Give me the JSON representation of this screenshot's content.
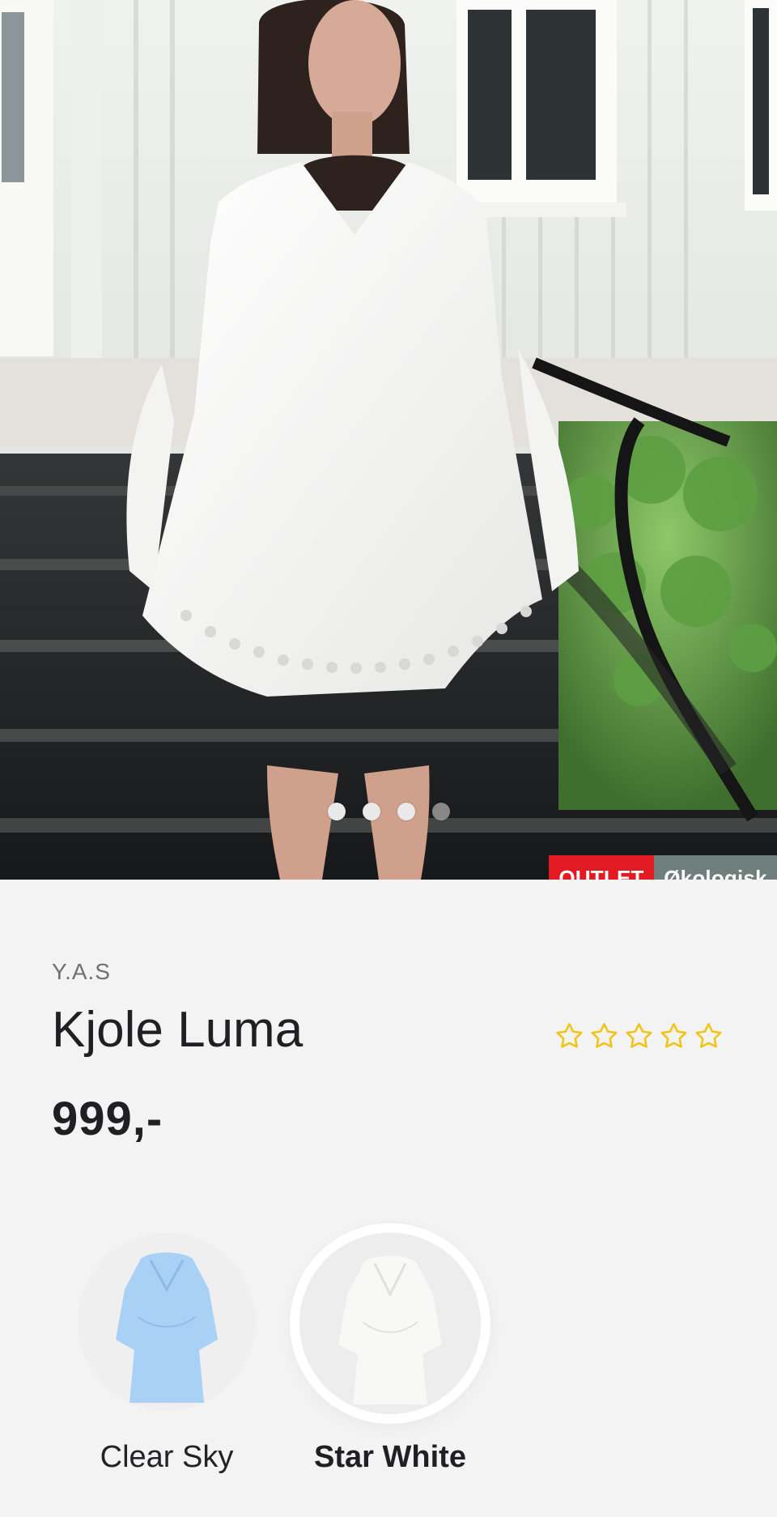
{
  "gallery": {
    "dots": [
      {
        "state": "active"
      },
      {
        "state": "active"
      },
      {
        "state": "active"
      },
      {
        "state": "inactive"
      }
    ],
    "badges": [
      {
        "label": "OUTLET",
        "color": "#e21b23"
      },
      {
        "label": "Økologisk",
        "color": "#6f807c"
      }
    ]
  },
  "product": {
    "brand": "Y.A.S",
    "title": "Kjole Luma",
    "rating": {
      "filled_stars": 0,
      "max_stars": 5,
      "star_color": "#f0c419"
    },
    "price": "999,-"
  },
  "colors": {
    "options": [
      {
        "label": "Clear Sky",
        "selected": false,
        "swatch_color": "#a9d0f5"
      },
      {
        "label": "Star White",
        "selected": true,
        "swatch_color": "#f7f7f5"
      }
    ]
  }
}
